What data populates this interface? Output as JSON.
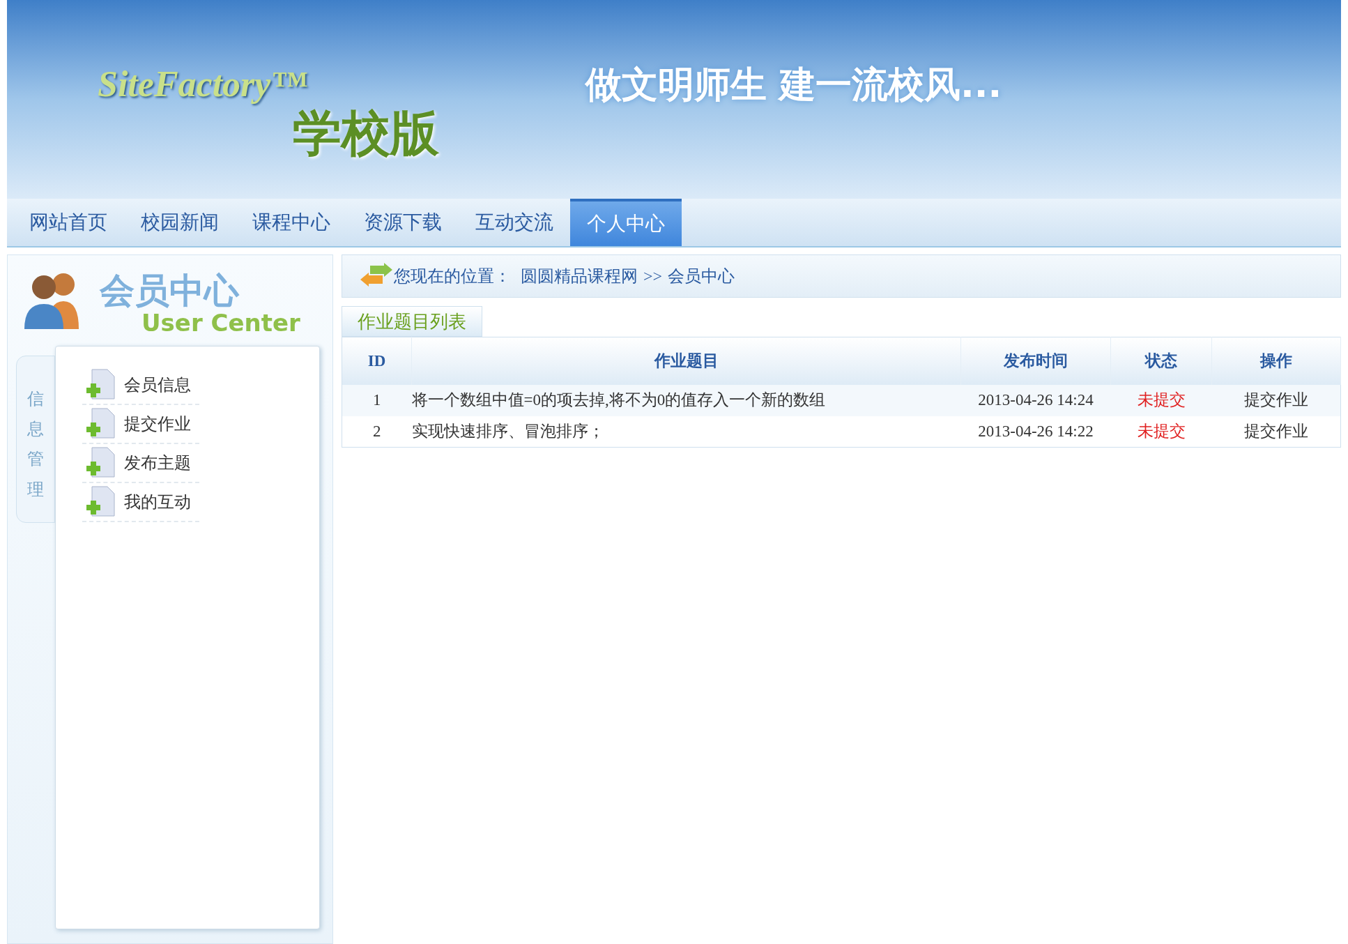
{
  "banner": {
    "logo": "SiteFactory™",
    "edition": "学校版",
    "slogan": "做文明师生 建一流校风..."
  },
  "nav": [
    {
      "label": "网站首页",
      "selected": false
    },
    {
      "label": "校园新闻",
      "selected": false
    },
    {
      "label": "课程中心",
      "selected": false
    },
    {
      "label": "资源下载",
      "selected": false
    },
    {
      "label": "互动交流",
      "selected": false
    },
    {
      "label": "个人中心",
      "selected": true
    }
  ],
  "sidebar": {
    "title": "会员中心",
    "subtitle": "User Center",
    "group_tab": "信息管理",
    "items": [
      {
        "label": "会员信息"
      },
      {
        "label": "提交作业"
      },
      {
        "label": "发布主题"
      },
      {
        "label": "我的互动"
      }
    ]
  },
  "breadcrumb": {
    "prefix": "您现在的位置：",
    "links": [
      "圆圆精品课程网",
      "会员中心"
    ],
    "separator": ">>"
  },
  "section_tab": "作业题目列表",
  "table": {
    "columns": [
      "ID",
      "作业题目",
      "发布时间",
      "状态",
      "操作"
    ],
    "rows": [
      {
        "id": "1",
        "title": "将一个数组中值=0的项去掉,将不为0的值存入一个新的数组",
        "time": "2013-04-26 14:24",
        "status": "未提交",
        "submitted": false,
        "action": "提交作业"
      },
      {
        "id": "2",
        "title": "实现快速排序、冒泡排序；",
        "time": "2013-04-26 14:22",
        "status": "未提交",
        "submitted": false,
        "action": "提交作业"
      }
    ]
  }
}
